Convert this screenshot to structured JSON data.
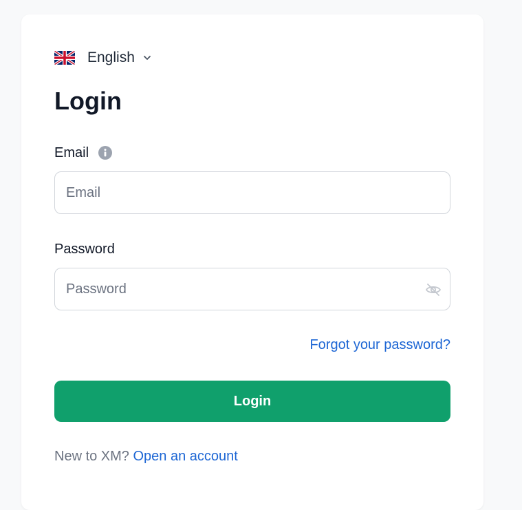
{
  "language": {
    "label": "English",
    "flag_icon": "uk-flag-icon",
    "dropdown_icon": "chevron-down-icon"
  },
  "form": {
    "title": "Login",
    "email": {
      "label": "Email",
      "placeholder": "Email",
      "value": "",
      "info_icon": "info-icon"
    },
    "password": {
      "label": "Password",
      "placeholder": "Password",
      "value": "",
      "toggle_icon": "eye-slash-icon"
    },
    "forgot_link": "Forgot your password?",
    "submit_label": "Login",
    "signup_prompt": "New to XM?",
    "signup_link": "Open an account"
  },
  "colors": {
    "primary_button": "#10a06c",
    "link": "#1d66d4",
    "page_background": "#f8f9fa",
    "card_background": "#ffffff"
  }
}
